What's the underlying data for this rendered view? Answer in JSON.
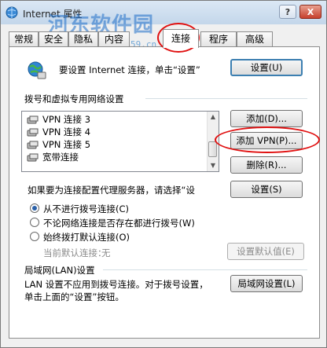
{
  "window": {
    "title": "Internet 属性",
    "help_button": "?",
    "close_button": "X"
  },
  "watermark": {
    "text": "河东软件园",
    "url": "www.pc0359.cn"
  },
  "tabs": [
    {
      "label": "常规"
    },
    {
      "label": "安全"
    },
    {
      "label": "隐私"
    },
    {
      "label": "内容"
    },
    {
      "label": "连接",
      "active": true
    },
    {
      "label": "程序"
    },
    {
      "label": "高级"
    }
  ],
  "setup": {
    "text": "要设置 Internet 连接，单击“设置”",
    "button": "设置(U)"
  },
  "dialup": {
    "section_title": "拨号和虚拟专用网络设置",
    "items": [
      "VPN 连接 3",
      "VPN 连接 4",
      "VPN 连接 5",
      "宽带连接"
    ],
    "add_button": "添加(D)...",
    "add_vpn_button": "添加 VPN(P)...",
    "delete_button": "删除(R)...",
    "proxy_text": "如果要为连接配置代理服务器，请选择“设",
    "settings_button": "设置(S)",
    "radio_never": "从不进行拨号连接(C)",
    "radio_no_network": "不论网络连接是否存在都进行拨号(W)",
    "radio_always": "始终拨打默认连接(O)",
    "current_default_label": "当前默认连接：",
    "current_default_value": "无",
    "set_default_button": "设置默认值(E)"
  },
  "lan": {
    "section_title": "局域网(LAN)设置",
    "description_line1": "LAN 设置不应用到拨号连接。对于拨号设置，",
    "description_line2": "单击上面的“设置”按钮。",
    "button": "局域网设置(L)"
  },
  "colors": {
    "accent": "#3c7fb1",
    "highlight_ring": "#e01010",
    "watermark": "#1e6ec8"
  }
}
